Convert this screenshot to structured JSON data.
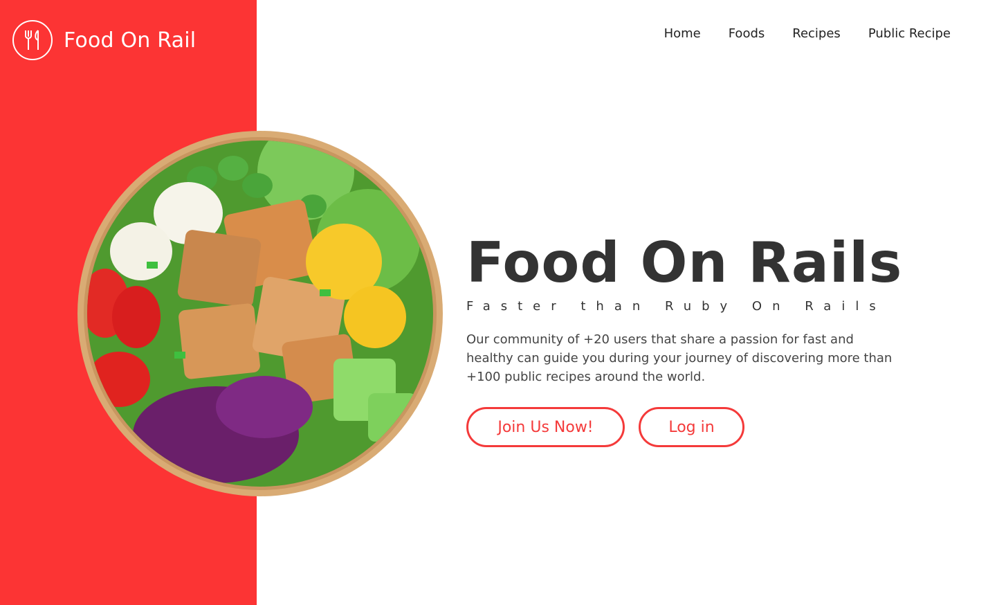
{
  "brand": {
    "name": "Food On Rail",
    "icon": "fork-knife-icon"
  },
  "nav": {
    "items": [
      "Home",
      "Foods",
      "Recipes",
      "Public Recipe"
    ]
  },
  "hero": {
    "title": "Food On Rails",
    "subtitle": "Faster than Ruby On Rails",
    "description": "Our community of +20 users that share a passion for fast and healthy can guide you during your journey of discovering more than +100 public recipes around the world.",
    "join_label": "Join Us Now!",
    "login_label": "Log in"
  },
  "colors": {
    "accent": "#fc3434",
    "text": "#333333"
  }
}
